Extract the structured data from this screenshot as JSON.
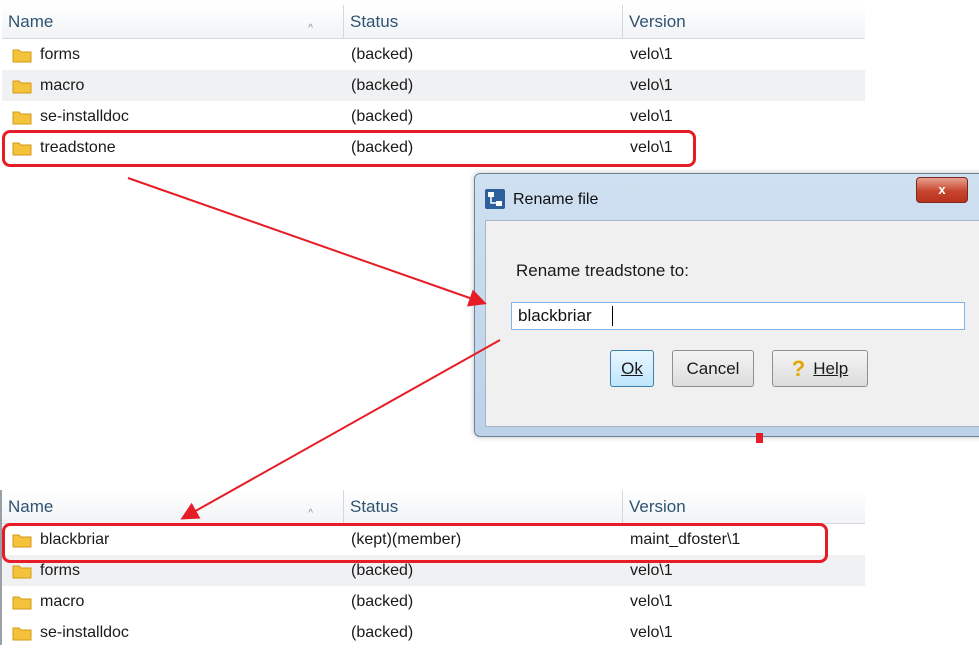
{
  "top_table": {
    "headers": {
      "name": "Name",
      "status": "Status",
      "version": "Version"
    },
    "rows": [
      {
        "name": "forms",
        "status": "(backed)",
        "version": "velo\\1"
      },
      {
        "name": "macro",
        "status": "(backed)",
        "version": "velo\\1"
      },
      {
        "name": "se-installdoc",
        "status": "(backed)",
        "version": "velo\\1"
      },
      {
        "name": "treadstone",
        "status": "(backed)",
        "version": "velo\\1"
      }
    ]
  },
  "dialog": {
    "title": "Rename file",
    "prompt": "Rename treadstone to:",
    "input_value": "blackbriar",
    "ok_label": "Ok",
    "cancel_label": "Cancel",
    "help_label": "Help",
    "close_label": "x"
  },
  "bottom_table": {
    "headers": {
      "name": "Name",
      "status": "Status",
      "version": "Version"
    },
    "rows": [
      {
        "name": "blackbriar",
        "status": "(kept)(member)",
        "version": "maint_dfoster\\1"
      },
      {
        "name": "forms",
        "status": "(backed)",
        "version": "velo\\1"
      },
      {
        "name": "macro",
        "status": "(backed)",
        "version": "velo\\1"
      },
      {
        "name": "se-installdoc",
        "status": "(backed)",
        "version": "velo\\1"
      }
    ]
  },
  "colors": {
    "highlight": "#e61d26",
    "folder": "#f5c33b",
    "header_text": "#2f5372"
  },
  "icons": {
    "folder": "folder-icon",
    "sort": "sort-arrow-icon",
    "app": "app-icon",
    "close": "close-icon",
    "help": "help-icon"
  }
}
